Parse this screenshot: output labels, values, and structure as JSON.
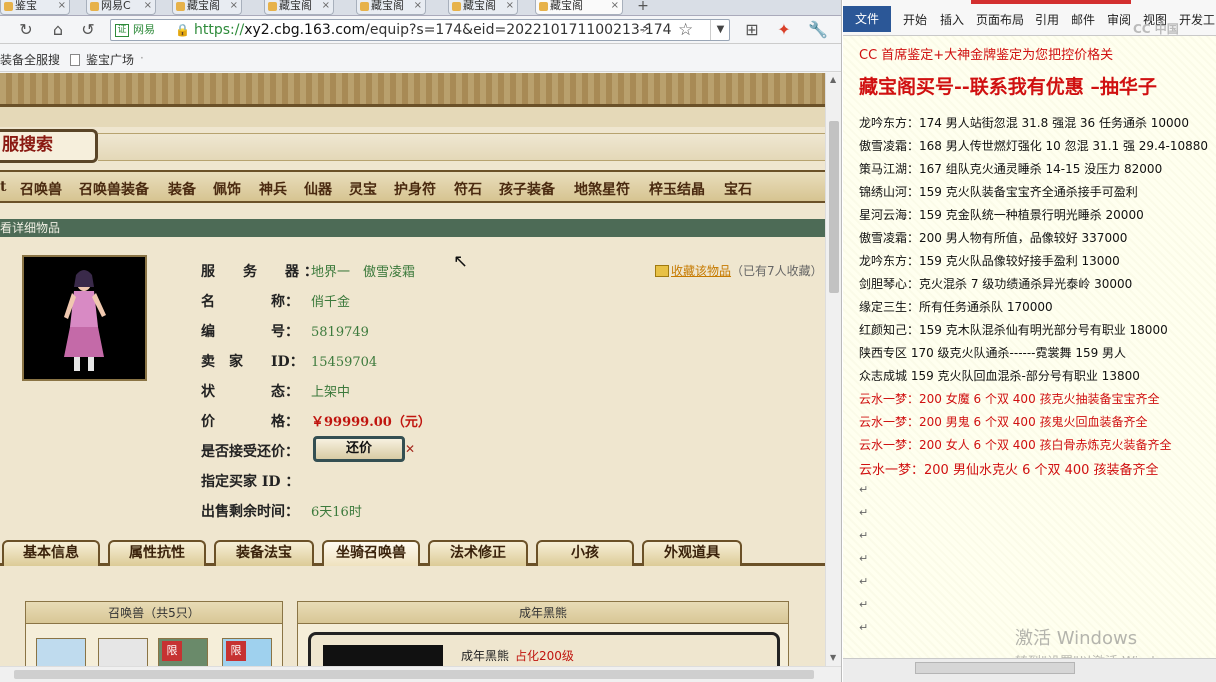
{
  "browser": {
    "tabs": [
      {
        "label": "鉴宝"
      },
      {
        "label": "网易C"
      },
      {
        "label": "藏宝阁"
      },
      {
        "label": "藏宝阁"
      },
      {
        "label": "藏宝阁"
      },
      {
        "label": "藏宝阁"
      },
      {
        "label": "藏宝阁"
      }
    ],
    "new_tab": "+",
    "url": {
      "badge": "网易",
      "scheme": "https://",
      "host": "xy2.cbg.163.com",
      "path": "/equip?s=174&eid=202210171100213-174"
    },
    "bookmarks": [
      {
        "label": "装备全服搜"
      },
      {
        "label": "鉴宝广场"
      }
    ],
    "bookmarks_overflow": "·"
  },
  "page": {
    "search_title": "服搜索",
    "menu": [
      "召唤兽",
      "召唤兽装备",
      "装备",
      "佩饰",
      "神兵",
      "仙器",
      "灵宝",
      "护身符",
      "符石",
      "孩子装备",
      "地煞星符",
      "梓玉结晶",
      "宝石"
    ],
    "menu_prefix": "t",
    "section_title": "看详细物品",
    "favorite": {
      "link": "收藏该物品",
      "count": "（已有7人收藏）"
    },
    "fields": [
      {
        "label": "服　　务　　器 ：",
        "value": "地界一　傲雪凌霜"
      },
      {
        "label": "名　　　　称：",
        "value": "俏千金"
      },
      {
        "label": "编　　　　号：",
        "value": "5819749"
      },
      {
        "label": "卖　家　　ID：",
        "value": "15459704"
      },
      {
        "label": "状　　　　态：",
        "value": "上架中"
      },
      {
        "label": "价　　　　格：",
        "value": "￥99999.00（元）"
      },
      {
        "label": "是否接受还价：",
        "value": ""
      },
      {
        "label": "指定买家 ID ：",
        "value": ""
      },
      {
        "label": "出售剩余时间：",
        "value": "6天16时"
      }
    ],
    "bargain_button": "还价",
    "detail_tabs": [
      "基本信息",
      "属性抗性",
      "装备法宝",
      "坐骑召唤兽",
      "法术修正",
      "小孩",
      "外观道具"
    ],
    "summon_panel": {
      "title": "召唤兽（共5只）",
      "limit_badge": "限"
    },
    "adult_panel": {
      "title": "成年黑熊",
      "name": "成年黑熊",
      "red": "占化200级"
    }
  },
  "word": {
    "file_tab": "文件",
    "ribbon_tabs": [
      "开始",
      "插入",
      "页面布局",
      "引用",
      "邮件",
      "审阅",
      "视图",
      "开发工"
    ],
    "logo": "CC 中国",
    "lines": [
      {
        "text": "CC 首席鉴定+大神金牌鉴定为您把控价格关",
        "style": "header"
      },
      {
        "text": "藏宝阁买号--联系我有优惠 –抽华子",
        "style": "big"
      },
      {
        "text": "龙吟东方：174 男人站街忽混 31.8 强混 36 任务通杀 10000",
        "style": "normal"
      },
      {
        "text": "傲雪凌霜：168 男人传世燃灯强化 10 忽混 31.1 强 29.4-10880",
        "style": "normal"
      },
      {
        "text": "策马江湖：167 组队克火通灵睡杀 14-15 没压力 82000",
        "style": "normal"
      },
      {
        "text": "锦绣山河：159 克火队装备宝宝齐全通杀接手可盈利",
        "style": "normal"
      },
      {
        "text": "星河云海：159 克金队统一种植景行明光睡杀 20000",
        "style": "normal"
      },
      {
        "text": "傲雪凌霜：200 男人物有所值，品像较好 337000",
        "style": "normal"
      },
      {
        "text": "龙吟东方：159 克火队品像较好接手盈利 13000",
        "style": "normal"
      },
      {
        "text": "剑胆琴心：克火混杀 7 级功绩通杀异光泰岭 30000",
        "style": "normal"
      },
      {
        "text": "缘定三生：所有任务通杀队 170000",
        "style": "normal"
      },
      {
        "text": "红颜知己：159 克木队混杀仙有明光部分号有职业 18000",
        "style": "normal"
      },
      {
        "text": "陕西专区 170 级克火队通杀------霓裳舞 159 男人",
        "style": "normal"
      },
      {
        "text": "众志成城 159 克火队回血混杀-部分号有职业 13800",
        "style": "normal"
      },
      {
        "text": "云水一梦：200 女魔 6 个双 400 孩克火抽装备宝宝齐全",
        "style": "red"
      },
      {
        "text": "云水一梦：200 男鬼 6 个双 400 孩鬼火回血装备齐全",
        "style": "red"
      },
      {
        "text": "云水一梦：200 女人 6 个双 400 孩白骨赤炼克火装备齐全",
        "style": "red"
      },
      {
        "text": "云水一梦：200 男仙水克火 6 个双 400 孩装备齐全",
        "style": "red"
      }
    ],
    "para_mark": "↵",
    "activation_title": "激活 Windows",
    "activation_sub": "转到\"设置\"以激活 Windows。"
  }
}
